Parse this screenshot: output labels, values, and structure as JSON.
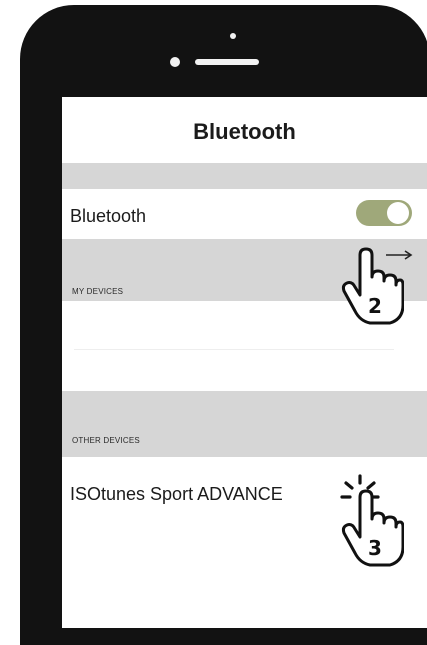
{
  "screen": {
    "nav_title": "Bluetooth"
  },
  "bluetooth_row": {
    "label": "Bluetooth",
    "toggle_on": true
  },
  "sections": {
    "my_devices": "MY DEVICES",
    "other_devices": "OTHER DEVICES"
  },
  "devices": {
    "other": [
      {
        "name": "ISOtunes Sport ADVANCE"
      }
    ]
  },
  "annotations": {
    "step_2": "2",
    "step_3": "3"
  },
  "icons": {
    "hand_pointer": "hand-pointer-icon",
    "tap_burst": "tap-burst-icon",
    "arrow": "right-arrow-icon"
  },
  "colors": {
    "toggle_on": "#9fa87a",
    "section_band": "#d6d6d6",
    "phone_frame": "#121212"
  }
}
